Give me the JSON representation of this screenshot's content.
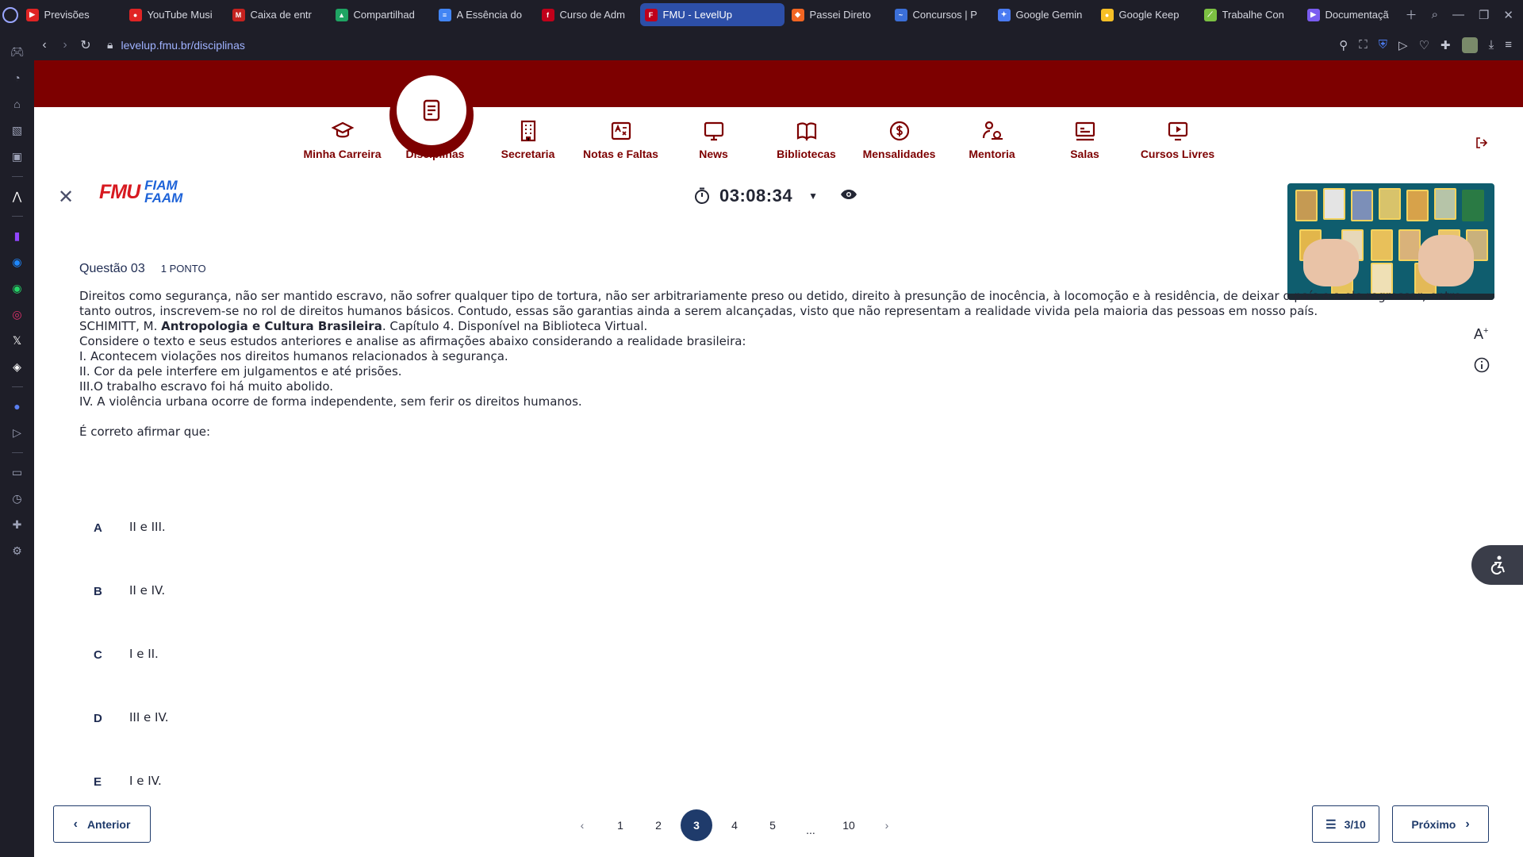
{
  "browser": {
    "tabs": [
      {
        "title": "Previsões",
        "color": "#e02424",
        "glyph": "▶"
      },
      {
        "title": "YouTube Musi",
        "color": "#e02424",
        "glyph": "●"
      },
      {
        "title": "Caixa de entr",
        "color": "#c5221f",
        "glyph": "M"
      },
      {
        "title": "Compartilhad",
        "color": "#1fa463",
        "glyph": "▲"
      },
      {
        "title": "A Essência do",
        "color": "#4285f4",
        "glyph": "≡"
      },
      {
        "title": "Curso de Adm",
        "color": "#c0001a",
        "glyph": "f"
      },
      {
        "title": "FMU - LevelUp",
        "color": "#c0001a",
        "glyph": "F"
      },
      {
        "title": "Passei Direto",
        "color": "#f26522",
        "glyph": "◆"
      },
      {
        "title": "Concursos | P",
        "color": "#3b6fd8",
        "glyph": "~"
      },
      {
        "title": "Google Gemin",
        "color": "#4a7bf2",
        "glyph": "✦"
      },
      {
        "title": "Google Keep",
        "color": "#f6bf26",
        "glyph": "●"
      },
      {
        "title": "Trabalhe Con",
        "color": "#7cc142",
        "glyph": "⟋"
      },
      {
        "title": "Documentaçã",
        "color": "#7a5cf0",
        "glyph": "▶"
      }
    ],
    "active_tab_index": 6,
    "url": "levelup.fmu.br/disciplinas"
  },
  "nav": {
    "items": [
      {
        "label": "Minha Carreira",
        "icon": "graduation-cap-icon"
      },
      {
        "label": "Disciplinas",
        "icon": "document-icon"
      },
      {
        "label": "Secretaria",
        "icon": "building-icon"
      },
      {
        "label": "Notas e Faltas",
        "icon": "grades-icon"
      },
      {
        "label": "News",
        "icon": "monitor-icon"
      },
      {
        "label": "Bibliotecas",
        "icon": "book-icon"
      },
      {
        "label": "Mensalidades",
        "icon": "dollar-icon"
      },
      {
        "label": "Mentoria",
        "icon": "mentor-icon"
      },
      {
        "label": "Salas",
        "icon": "classroom-icon"
      },
      {
        "label": "Cursos Livres",
        "icon": "play-icon"
      }
    ],
    "active_index": 1
  },
  "header": {
    "logo_fmu": "FMU",
    "logo_fiam_1": "FIAM",
    "logo_fiam_2": "FAAM",
    "timer": "03:08:34"
  },
  "question": {
    "title": "Questão 03",
    "points": "1 PONTO",
    "paragraph_1": "Direitos como segurança, não ser mantido escravo, não sofrer qualquer tipo de tortura, não ser arbitrariamente preso ou detido, direito à presunção de inocência, à locomoção e à residência, de deixar o país e a ele regressar, entre tanto outros, inscrevem-se no rol de direitos humanos básicos. Contudo, essas são garantias ainda a serem alcançadas, visto que não representam a realidade vivida pela maioria das pessoas em nosso país.",
    "citation_author": " SCHIMITT, M. ",
    "citation_book": "Antropologia e Cultura Brasileira",
    "citation_rest": ". Capítulo 4. Disponível na Biblioteca Virtual.",
    "instruction": "Considere o texto e seus estudos anteriores e analise as afirmações abaixo considerando a realidade brasileira:",
    "statements": [
      "I. Acontecem violações nos direitos humanos relacionados à segurança.",
      "II. Cor da pele interfere em julgamentos e até prisões.",
      "III.O trabalho escravo foi há muito abolido.",
      "IV. A violência urbana ocorre de forma independente, sem ferir os direitos humanos."
    ],
    "prompt": "É correto afirmar que:",
    "options": [
      {
        "letter": "A",
        "text": "II e III."
      },
      {
        "letter": "B",
        "text": "II e IV."
      },
      {
        "letter": "C",
        "text": "I e II."
      },
      {
        "letter": "D",
        "text": "III e IV."
      },
      {
        "letter": "E",
        "text": "I e IV."
      }
    ]
  },
  "footer": {
    "prev_label": "Anterior",
    "next_label": "Próximo",
    "progress": "3/10",
    "pages": [
      "1",
      "2",
      "3",
      "4",
      "5",
      "...",
      "10"
    ],
    "current_page": "3"
  },
  "colors": {
    "brand_red": "#7d0000",
    "navy": "#1f3b6b",
    "active_tab": "#2d4fa8"
  }
}
